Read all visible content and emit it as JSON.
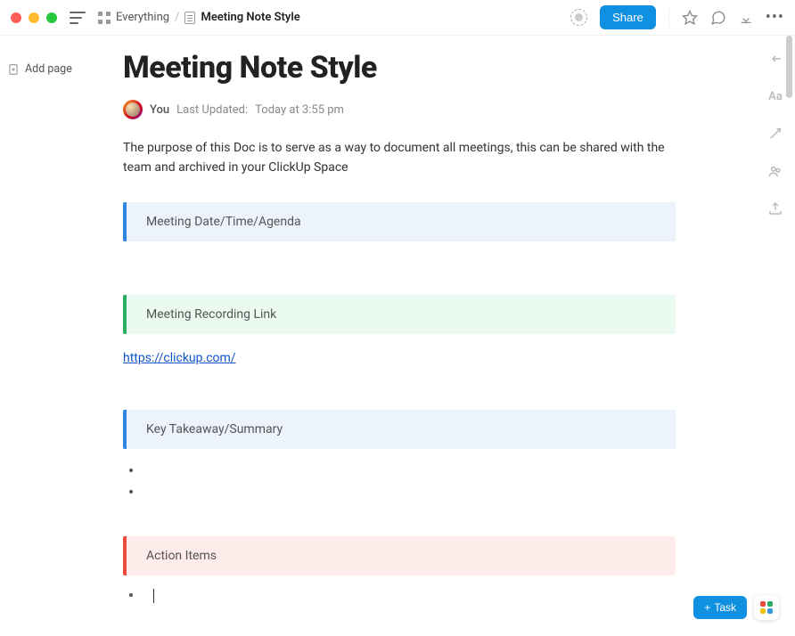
{
  "breadcrumb": {
    "root": "Everything",
    "current": "Meeting Note Style"
  },
  "topbar": {
    "share": "Share"
  },
  "sidebar": {
    "add_page": "Add page"
  },
  "page": {
    "title": "Meeting Note Style",
    "author": "You",
    "updated_label": "Last Updated:",
    "updated_time": "Today at 3:55 pm",
    "intro": "The purpose of this Doc is to serve as a way to document all meetings, this can be shared with the team and archived in your ClickUp Space"
  },
  "banners": {
    "meeting": "Meeting Date/Time/Agenda",
    "recording": "Meeting Recording Link",
    "takeaway": "Key Takeaway/Summary",
    "actions": "Action Items"
  },
  "link": {
    "text": "https://clickup.com/",
    "href": "https://clickup.com/"
  },
  "bottom": {
    "task": "Task"
  }
}
